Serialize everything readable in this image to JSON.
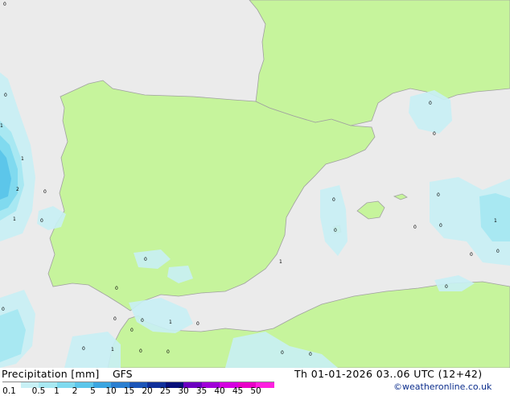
{
  "map": {
    "values": [
      "0",
      "0",
      "1",
      "1",
      "2",
      "0",
      "1",
      "0",
      "0",
      "0",
      "0",
      "0",
      "0",
      "0",
      "1",
      "0",
      "0",
      "0",
      "0",
      "1",
      "0",
      "0",
      "0",
      "0",
      "0",
      "1",
      "0",
      "0",
      "0",
      "0",
      "0",
      "1",
      "0",
      "0"
    ]
  },
  "footer": {
    "title": "Precipitation [mm]",
    "model": "GFS",
    "datetime": "Th 01-01-2026 03..06 UTC (12+42)",
    "credit": "©weatheronline.co.uk"
  },
  "legend": {
    "ticks": [
      "0.1",
      "0.5",
      "1",
      "2",
      "5",
      "10",
      "15",
      "20",
      "25",
      "30",
      "35",
      "40",
      "45",
      "50"
    ],
    "colors": [
      "#fefefe",
      "#c8f0f5",
      "#a8e8f2",
      "#80daef",
      "#5cc6ea",
      "#3ba5e0",
      "#2b7fd0",
      "#1c55b8",
      "#10309a",
      "#08107a",
      "#6c00c0",
      "#a000d8",
      "#d400e0",
      "#e800c8",
      "#ff20e0"
    ]
  },
  "colors": {
    "sea": "#ebebeb",
    "land": "#c6f49c",
    "border": "#a0a0a0"
  }
}
